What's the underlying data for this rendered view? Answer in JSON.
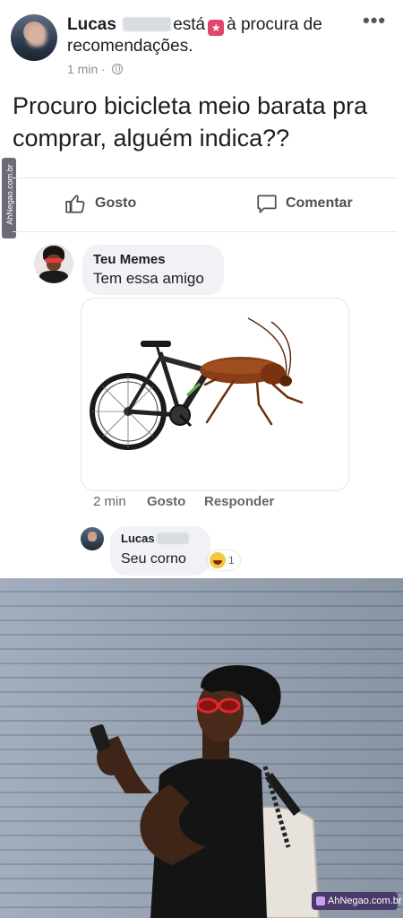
{
  "post": {
    "author": "Lucas",
    "verb": "está",
    "activity": "à procura de recomendações.",
    "time": "1 min",
    "more": "•••",
    "text": "Procuro bicicleta meio barata pra comprar, alguém indica??",
    "side_watermark": "AhNegao.com.br"
  },
  "actions": {
    "like": "Gosto",
    "comment": "Comentar"
  },
  "comments": [
    {
      "author": "Teu Memes",
      "text": "Tem essa amigo",
      "time": "2 min",
      "like": "Gosto",
      "reply": "Responder"
    },
    {
      "author": "Lucas",
      "text": "Seu corno",
      "reaction_count": "1"
    }
  ],
  "photo_watermark": "AhNegao.com.br",
  "colors": {
    "meta_gray": "#65676b",
    "bubble_bg": "#f0f2f5",
    "status_pink": "#e0456b"
  }
}
